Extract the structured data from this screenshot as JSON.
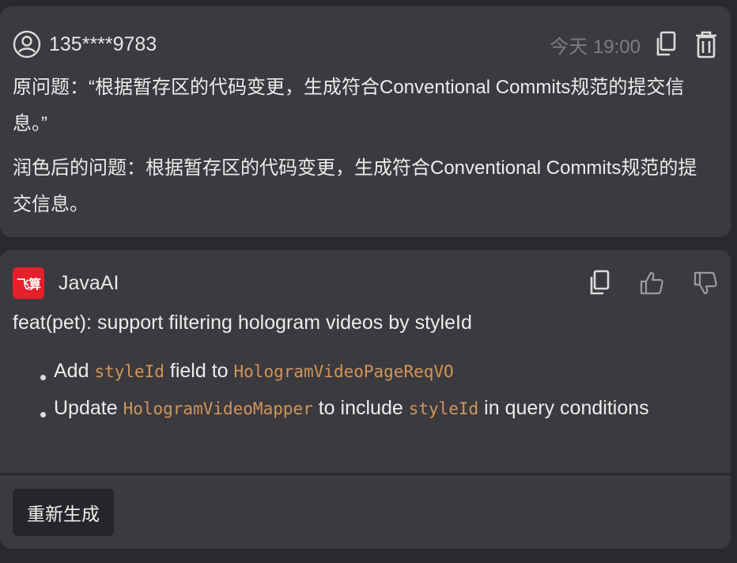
{
  "user_message": {
    "avatar_icon": "user-circle-icon",
    "username": "135****9783",
    "timestamp": "今天 19:00",
    "actions": {
      "copy_icon": "copy-icon",
      "delete_icon": "trash-icon"
    },
    "original_question": "原问题：“根据暂存区的代码变更，生成符合Conventional Commits规范的提交信息。”",
    "polished_question": "润色后的问题：根据暂存区的代码变更，生成符合Conventional Commits规范的提交信息。"
  },
  "ai_message": {
    "logo_text": "飞算",
    "logo_color": "#e5202a",
    "name": "JavaAI",
    "actions": {
      "copy_icon": "copy-icon",
      "like_icon": "thumbs-up-icon",
      "dislike_icon": "thumbs-down-icon"
    },
    "commit_title": "feat(pet): support filtering hologram videos by styleId",
    "bullets": [
      {
        "p1": "Add ",
        "code1": "styleId",
        "p2": " field to ",
        "code2": "HologramVideoPageReqVO",
        "p3": ""
      },
      {
        "p1": "Update ",
        "code1": "HologramVideoMapper",
        "p2": " to include ",
        "code2": "styleId",
        "p3": " in query conditions"
      }
    ],
    "regenerate_label": "重新生成"
  },
  "colors": {
    "background": "#2a2a2e",
    "card": "#3a3a3f",
    "code_text": "#d2955a",
    "muted": "#7c7c82"
  }
}
